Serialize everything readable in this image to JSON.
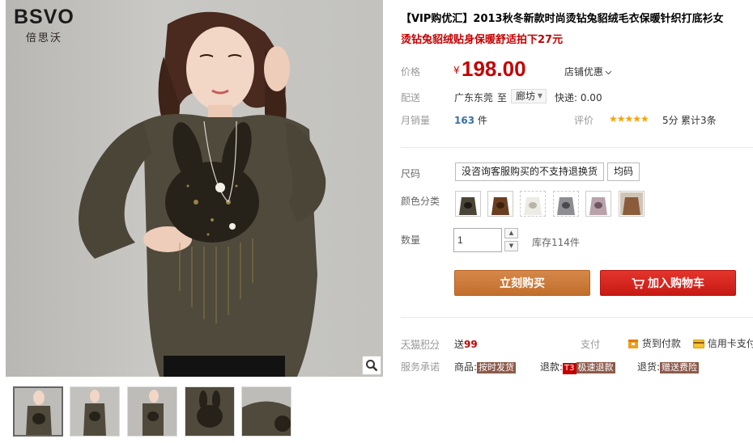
{
  "brand": {
    "name": "BSVO",
    "name_cn": "倍思沃"
  },
  "product": {
    "title": "【VIP购优汇】2013秋冬新款时尚烫钻兔貂绒毛衣保暖针织打底衫女",
    "subtitle": "烫钻兔貂绒贴身保暖舒适拍下27元"
  },
  "price": {
    "label": "价格",
    "currency": "¥",
    "value": "198.00",
    "promo": "店铺优惠"
  },
  "shipping": {
    "label": "配送",
    "from": "广东东莞",
    "to_word": "至",
    "destination": "廊坊",
    "express": "快递: 0.00"
  },
  "sales": {
    "label": "月销量",
    "count": "163",
    "unit": "件"
  },
  "rating": {
    "label": "评价",
    "stars": "★★★★★",
    "score": "5分",
    "total": "累计3条"
  },
  "size": {
    "label": "尺码",
    "options": [
      "没咨询客服购买的不支持退换货",
      "均码"
    ]
  },
  "color": {
    "label": "颜色分类"
  },
  "quantity": {
    "label": "数量",
    "value": "1",
    "stock": "库存114件",
    "up": "▲",
    "down": "▼"
  },
  "buttons": {
    "buy_now": "立刻购买",
    "add_cart": "加入购物车"
  },
  "points": {
    "label": "天猫积分",
    "prefix": "送",
    "value": "99",
    "pay_label": "支付",
    "cod": "货到付款",
    "card": "信用卡支付"
  },
  "service": {
    "label": "服务承诺",
    "goods": "商品:",
    "goods_tag": "按时发货",
    "refund": "退款:",
    "refund_badge": "T3",
    "refund_tag": "极速退款",
    "return": "退货:",
    "return_tag": "赠送费险"
  },
  "colors": {
    "price": "#c40000",
    "buy": "#c8773a",
    "cart": "#d3231c",
    "star": "#f7a20c"
  },
  "icons": [
    "zoom-icon",
    "cart-icon",
    "cod-icon",
    "card-icon",
    "chevron-down-icon"
  ]
}
